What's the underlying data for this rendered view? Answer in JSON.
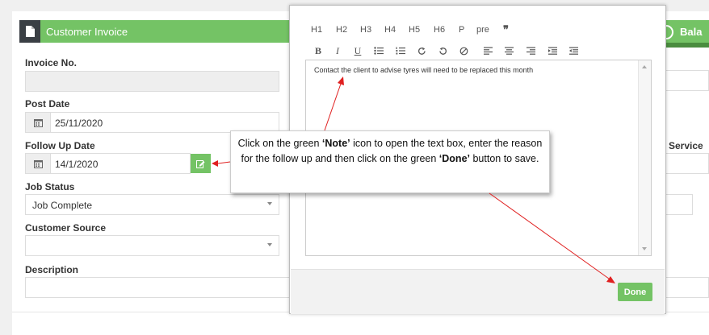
{
  "panel": {
    "title": "Customer Invoice",
    "right_title": "Bala"
  },
  "form": {
    "invoice_no_label": "Invoice No.",
    "invoice_no_value": "",
    "post_date_label": "Post Date",
    "post_date_value": "25/11/2020",
    "follow_up_label": "Follow Up Date",
    "follow_up_value": "14/1/2020",
    "job_status_label": "Job Status",
    "job_status_value": "Job Complete",
    "customer_source_label": "Customer Source",
    "customer_source_value": "",
    "description_label": "Description",
    "service_label": "Service"
  },
  "modal": {
    "headings": [
      "H1",
      "H2",
      "H3",
      "H4",
      "H5",
      "H6",
      "P",
      "pre",
      "❞"
    ],
    "editor_text": "Contact the client to advise tyres will need to be replaced this month",
    "done_label": "Done"
  },
  "callout": {
    "pre": "Click on the green ",
    "note": "‘Note’",
    "mid": " icon to open the text box, enter the reason for the follow up and then click on the green ",
    "done": "‘Done’",
    "post": " button to save."
  },
  "colors": {
    "accent": "#74c365",
    "header_icon_bg": "#3a3f44",
    "arrow": "#e02020"
  }
}
